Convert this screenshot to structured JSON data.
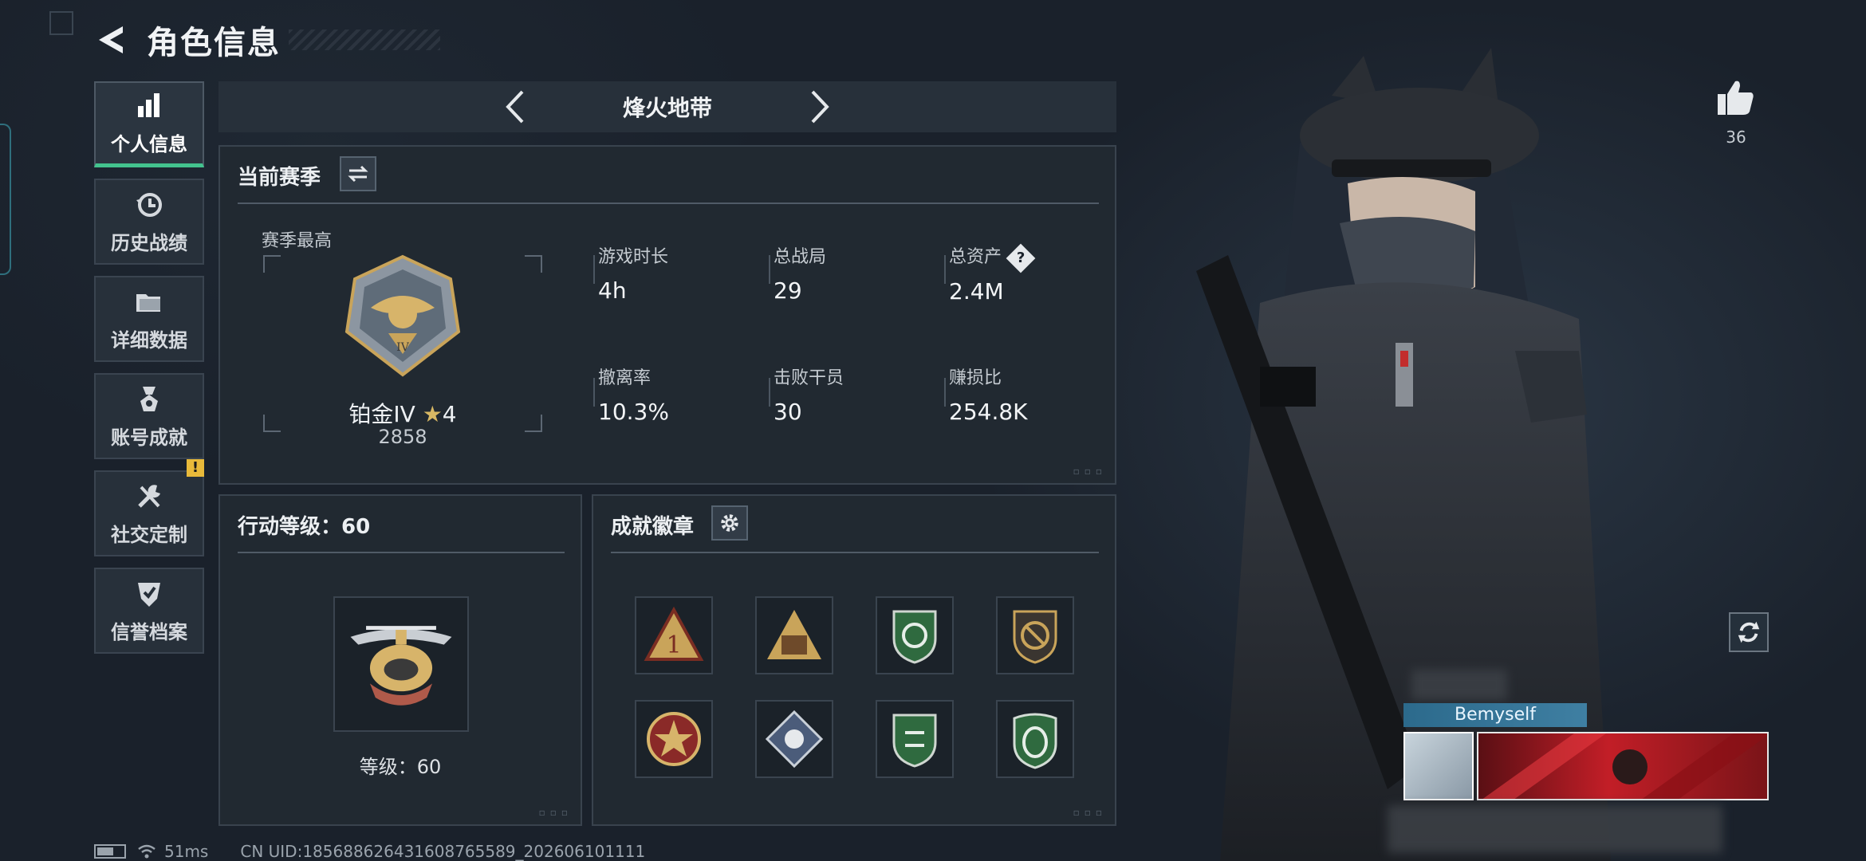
{
  "header": {
    "title": "角色信息"
  },
  "sidebar": {
    "items": [
      {
        "label": "个人信息",
        "icon": "bar-chart-icon",
        "active": true
      },
      {
        "label": "历史战绩",
        "icon": "history-clock-icon"
      },
      {
        "label": "详细数据",
        "icon": "folder-icon"
      },
      {
        "label": "账号成就",
        "icon": "medal-icon"
      },
      {
        "label": "社交定制",
        "icon": "wrench-tools-icon",
        "badge": "!"
      },
      {
        "label": "信誉档案",
        "icon": "shield-check-icon"
      }
    ]
  },
  "mode": {
    "name": "烽火地带"
  },
  "season": {
    "title": "当前赛季",
    "best_label": "赛季最高",
    "rank_name": "铂金IV",
    "rank_stars": "4",
    "rank_score": "2858",
    "stats": [
      {
        "key": "游戏时长",
        "value": "4h"
      },
      {
        "key": "总战局",
        "value": "29"
      },
      {
        "key": "总资产",
        "value": "2.4M",
        "help": "?"
      },
      {
        "key": "撤离率",
        "value": "10.3%"
      },
      {
        "key": "击败干员",
        "value": "30"
      },
      {
        "key": "赚损比",
        "value": "254.8K"
      }
    ]
  },
  "level": {
    "title": "行动等级：60",
    "caption": "等级：60"
  },
  "badges": {
    "title": "成就徽章",
    "items": [
      "badge-triangle-1-icon",
      "badge-triangle-squad-icon",
      "badge-green-shield-rotate-icon",
      "badge-no-gun-shield-icon",
      "badge-star-medal-icon",
      "badge-blue-diamond-icon",
      "badge-green-shield-arrows-icon",
      "badge-green-shield-emblem-icon"
    ]
  },
  "social": {
    "likes": "36"
  },
  "player": {
    "name": "Bemyself"
  },
  "status_bar": {
    "ping": "51ms",
    "uid": "CN UID:185688626431608765589_202606101111"
  },
  "colors": {
    "accent_green": "#43c38e",
    "panel_bg": "#212931",
    "background": "#1a212b",
    "warning": "#e8b93a"
  }
}
